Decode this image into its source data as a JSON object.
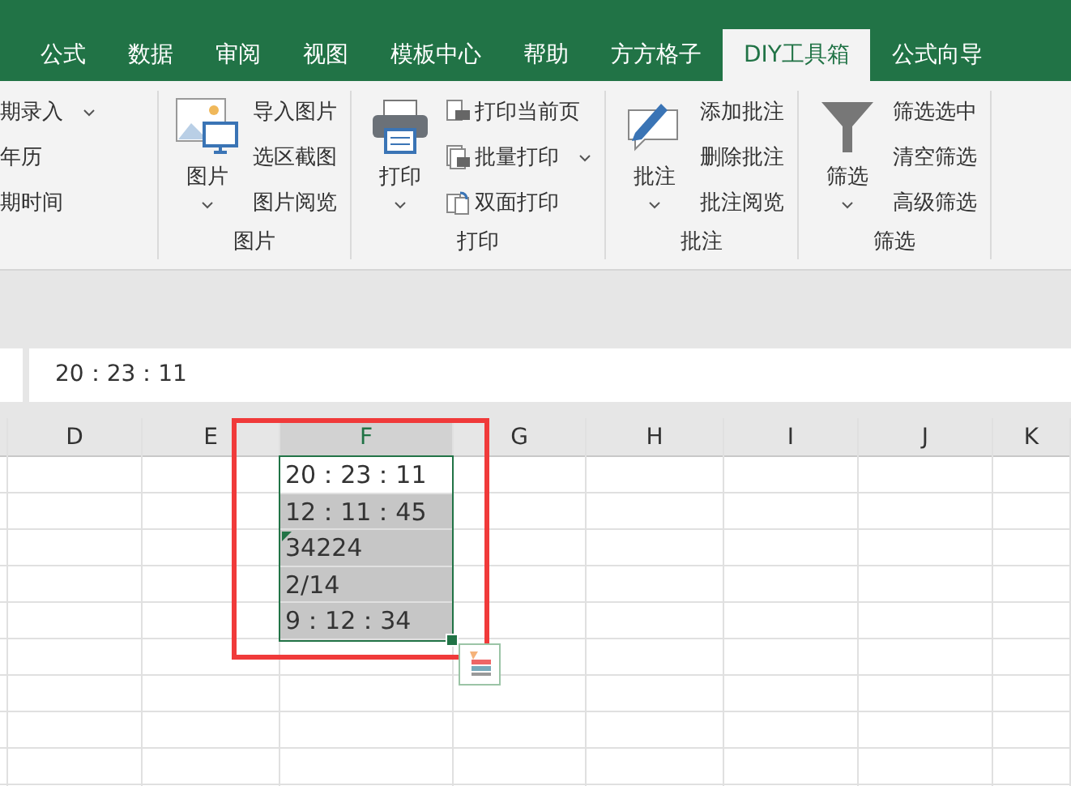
{
  "tabs": [
    {
      "label": "公式",
      "selected": false
    },
    {
      "label": "数据",
      "selected": false
    },
    {
      "label": "审阅",
      "selected": false
    },
    {
      "label": "视图",
      "selected": false
    },
    {
      "label": "模板中心",
      "selected": false
    },
    {
      "label": "帮助",
      "selected": false
    },
    {
      "label": "方方格子",
      "selected": false
    },
    {
      "label": "DIY工具箱",
      "selected": true
    },
    {
      "label": "公式向导",
      "selected": false
    }
  ],
  "ribbon_groups": [
    {
      "kind": "partial",
      "items": [
        {
          "label": "期录入",
          "kind": "plain",
          "dropdown": true
        },
        {
          "label": "年历",
          "kind": "plain",
          "dropdown": false
        },
        {
          "label": "期时间",
          "kind": "plain",
          "dropdown": false
        }
      ]
    },
    {
      "kind": "full",
      "label": "图片",
      "big_button": {
        "label": "图片",
        "kind": "picture",
        "dropdown": true
      },
      "items": [
        {
          "label": "导入图片",
          "kind": "plain",
          "dropdown": false
        },
        {
          "label": "选区截图",
          "kind": "plain",
          "dropdown": false
        },
        {
          "label": "图片阅览",
          "kind": "plain",
          "dropdown": false
        }
      ]
    },
    {
      "kind": "full",
      "label": "打印",
      "big_button": {
        "label": "打印",
        "kind": "printer",
        "dropdown": true
      },
      "items": [
        {
          "label": "打印当前页",
          "kind": "page-print",
          "dropdown": false
        },
        {
          "label": "批量打印",
          "kind": "batch-print",
          "dropdown": true
        },
        {
          "label": "双面打印",
          "kind": "duplex-print",
          "dropdown": false
        }
      ]
    },
    {
      "kind": "full",
      "label": "批注",
      "big_button": {
        "label": "批注",
        "kind": "comment",
        "dropdown": true
      },
      "items": [
        {
          "label": "添加批注",
          "kind": "plain",
          "dropdown": false
        },
        {
          "label": "删除批注",
          "kind": "plain",
          "dropdown": false
        },
        {
          "label": "批注阅览",
          "kind": "plain",
          "dropdown": false
        }
      ]
    },
    {
      "kind": "full",
      "label": "筛选",
      "big_button": {
        "label": "筛选",
        "kind": "filter",
        "dropdown": true
      },
      "items": [
        {
          "label": "筛选选中",
          "kind": "plain",
          "dropdown": false
        },
        {
          "label": "清空筛选",
          "kind": "plain",
          "dropdown": false
        },
        {
          "label": "高级筛选",
          "kind": "plain",
          "dropdown": false
        }
      ]
    }
  ],
  "formula_bar": {
    "value": "20：23：11"
  },
  "columns": [
    {
      "label": "D",
      "selected": false
    },
    {
      "label": "E",
      "selected": false
    },
    {
      "label": "F",
      "selected": true,
      "cells": [
        {
          "text": "20：23：11",
          "selected": true,
          "active": true,
          "error_flag": false
        },
        {
          "text": "12：11：45",
          "selected": true,
          "active": false,
          "error_flag": false
        },
        {
          "text": "34224",
          "selected": true,
          "active": false,
          "error_flag": true
        },
        {
          "text": "2/14",
          "selected": true,
          "active": false,
          "error_flag": false
        },
        {
          "text": "9：12：34",
          "selected": true,
          "active": false,
          "error_flag": false
        }
      ]
    },
    {
      "label": "G",
      "selected": false
    },
    {
      "label": "H",
      "selected": false
    },
    {
      "label": "I",
      "selected": false
    },
    {
      "label": "J",
      "selected": false
    },
    {
      "label": "K",
      "selected": false
    }
  ]
}
